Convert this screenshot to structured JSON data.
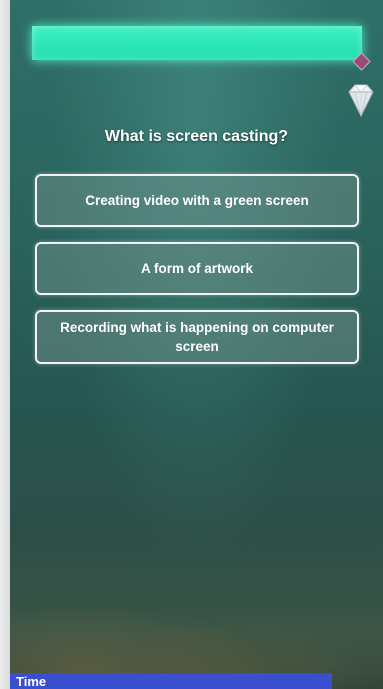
{
  "hud": {
    "progress_bar_color": "#2fe6b8",
    "marker_icon": "diamond-marker-icon",
    "gem_icon": "diamond-gem-icon"
  },
  "question": {
    "text": "What is screen casting?"
  },
  "answers": [
    {
      "label": "Creating video with a green screen"
    },
    {
      "label": "A form of artwork"
    },
    {
      "label": "Recording what is happening on computer screen"
    }
  ],
  "timer": {
    "label": "Time",
    "color": "#3a4ed0"
  }
}
